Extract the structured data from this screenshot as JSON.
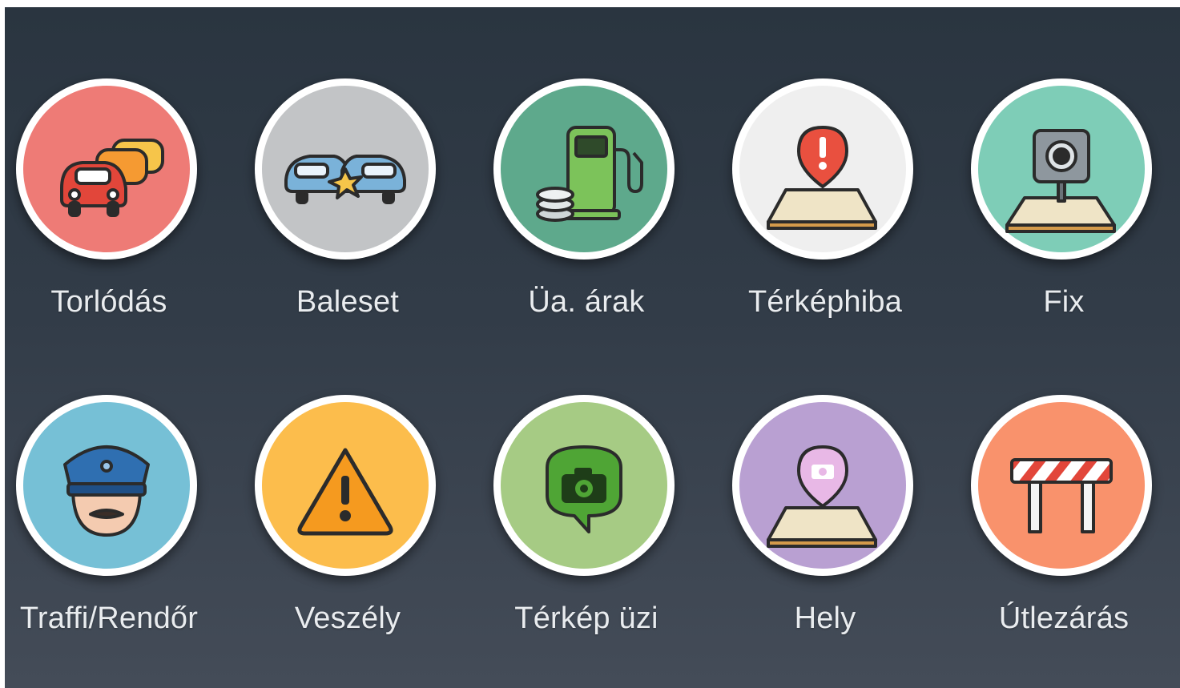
{
  "report_menu": {
    "items": [
      {
        "label": "Torlódás",
        "icon": "traffic-jam-icon",
        "color": "#ee7b76"
      },
      {
        "label": "Baleset",
        "icon": "accident-icon",
        "color": "#c2c4c6"
      },
      {
        "label": "Üa. árak",
        "icon": "gas-price-icon",
        "color": "#5ea98c"
      },
      {
        "label": "Térképhiba",
        "icon": "map-error-icon",
        "color": "#efefef"
      },
      {
        "label": "Fix",
        "icon": "speed-camera-icon",
        "color": "#7ecdb7"
      },
      {
        "label": "Traffi/Rendőr",
        "icon": "police-icon",
        "color": "#76c0d6"
      },
      {
        "label": "Veszély",
        "icon": "hazard-icon",
        "color": "#fcbd4c"
      },
      {
        "label": "Térkép üzi",
        "icon": "map-chat-icon",
        "color": "#a6cb84"
      },
      {
        "label": "Hely",
        "icon": "place-icon",
        "color": "#b9a0d2"
      },
      {
        "label": "Útlezárás",
        "icon": "road-closure-icon",
        "color": "#f9926c"
      }
    ]
  }
}
